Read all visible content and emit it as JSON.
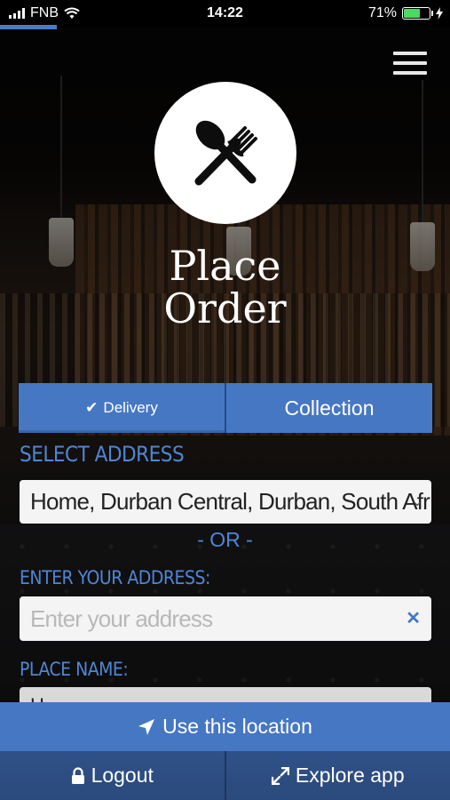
{
  "status_bar": {
    "carrier": "FNB",
    "time": "14:22",
    "battery_percent": "71%",
    "battery_level": 0.71,
    "battery_color": "#4cd964"
  },
  "header": {
    "menu_icon": "hamburger-menu-icon",
    "logo_icon": "spoon-fork-crossed-icon",
    "title_line1": "Place",
    "title_line2": "Order"
  },
  "order_type": {
    "delivery_label": "Delivery",
    "delivery_icon": "checkmark-icon",
    "collection_label": "Collection",
    "selected": "Delivery"
  },
  "form": {
    "select_address_label": "SELECT ADDRESS",
    "selected_address": "Home, Durban Central, Durban, South Afr",
    "or_text": "- OR -",
    "enter_address_label": "ENTER YOUR ADDRESS:",
    "address_placeholder": "Enter your address",
    "address_value": "",
    "clear_icon": "clear-x-icon",
    "place_name_label": "PLACE NAME:",
    "place_name_value": "H"
  },
  "actions": {
    "use_location_label": "Use this location",
    "use_location_icon": "location-arrow-icon"
  },
  "bottom_nav": {
    "logout_label": "Logout",
    "logout_icon": "lock-icon",
    "explore_label": "Explore app",
    "explore_icon": "expand-arrows-icon"
  },
  "colors": {
    "accent": "#4677c3",
    "label_blue": "#4f86d4",
    "bottom_bar": "#2d4e84"
  }
}
